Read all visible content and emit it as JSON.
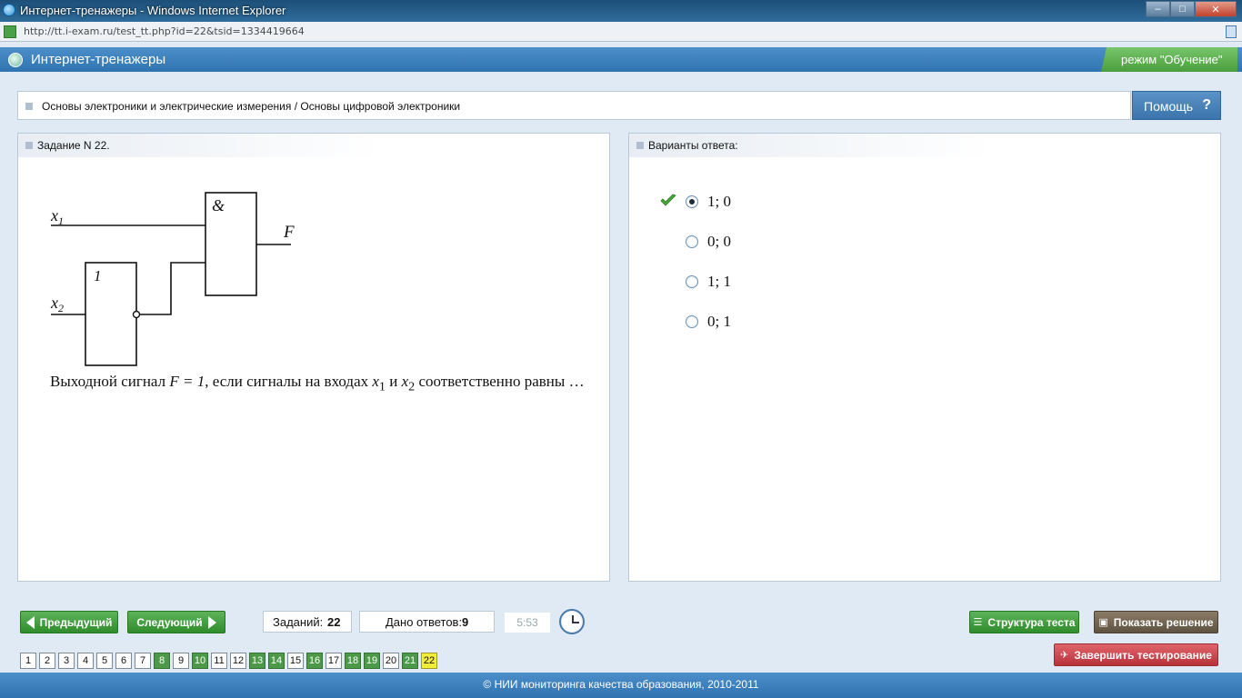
{
  "window": {
    "title": "Интернет-тренажеры - Windows Internet Explorer",
    "url": "http://tt.i-exam.ru/test_tt.php?id=22&tsid=1334419664",
    "controls": [
      "–",
      "□",
      "✕"
    ]
  },
  "header": {
    "app_title": "Интернет-тренажеры",
    "mode": "режим \"Обучение\""
  },
  "breadcrumb": "Основы электроники и электрические измерения / Основы цифровой электроники",
  "help_label": "Помощь",
  "help_icon": "?",
  "question": {
    "heading": "Задание N 22.",
    "circuit": {
      "and_gate_label": "&",
      "not_gate_label": "1",
      "input1": "x",
      "input1_sub": "1",
      "input2": "x",
      "input2_sub": "2",
      "output": "F"
    },
    "text_part1": "Выходной сигнал ",
    "text_formula": "F = 1",
    "text_part2": ", если сигналы на входах ",
    "text_x1": "x",
    "text_x1_sub": "1",
    "text_and": " и ",
    "text_x2": "x",
    "text_x2_sub": "2",
    "text_part3": " соответственно равны …"
  },
  "answers": {
    "heading": "Варианты ответа:",
    "options": [
      {
        "label": "1; 0",
        "selected": true,
        "correct": true
      },
      {
        "label": "0; 0",
        "selected": false,
        "correct": false
      },
      {
        "label": "1; 1",
        "selected": false,
        "correct": false
      },
      {
        "label": "0; 1",
        "selected": false,
        "correct": false
      }
    ]
  },
  "toolbar": {
    "prev_label": "Предыдущий",
    "next_label": "Следующий",
    "tasks_label": "Заданий:",
    "tasks_count": "22",
    "answered_label": "Дано ответов:",
    "answered_count": "9",
    "timer": "5:53",
    "structure_label": "Структура теста",
    "solution_label": "Показать решение",
    "finish_label": "Завершить тестирование"
  },
  "task_nav": [
    {
      "n": "1",
      "state": "normal"
    },
    {
      "n": "2",
      "state": "normal"
    },
    {
      "n": "3",
      "state": "normal"
    },
    {
      "n": "4",
      "state": "normal"
    },
    {
      "n": "5",
      "state": "normal"
    },
    {
      "n": "6",
      "state": "normal"
    },
    {
      "n": "7",
      "state": "normal"
    },
    {
      "n": "8",
      "state": "answered"
    },
    {
      "n": "9",
      "state": "normal"
    },
    {
      "n": "10",
      "state": "answered"
    },
    {
      "n": "11",
      "state": "normal"
    },
    {
      "n": "12",
      "state": "normal"
    },
    {
      "n": "13",
      "state": "answered"
    },
    {
      "n": "14",
      "state": "answered"
    },
    {
      "n": "15",
      "state": "normal"
    },
    {
      "n": "16",
      "state": "answered"
    },
    {
      "n": "17",
      "state": "normal"
    },
    {
      "n": "18",
      "state": "answered"
    },
    {
      "n": "19",
      "state": "answered"
    },
    {
      "n": "20",
      "state": "normal"
    },
    {
      "n": "21",
      "state": "answered"
    },
    {
      "n": "22",
      "state": "current"
    }
  ],
  "footer": "© НИИ мониторинга качества образования, 2010-2011",
  "colors": {
    "accent": "#3a7cbc",
    "answered": "#4c9a48",
    "current": "#f2ec3a",
    "finish": "#c43c44"
  }
}
